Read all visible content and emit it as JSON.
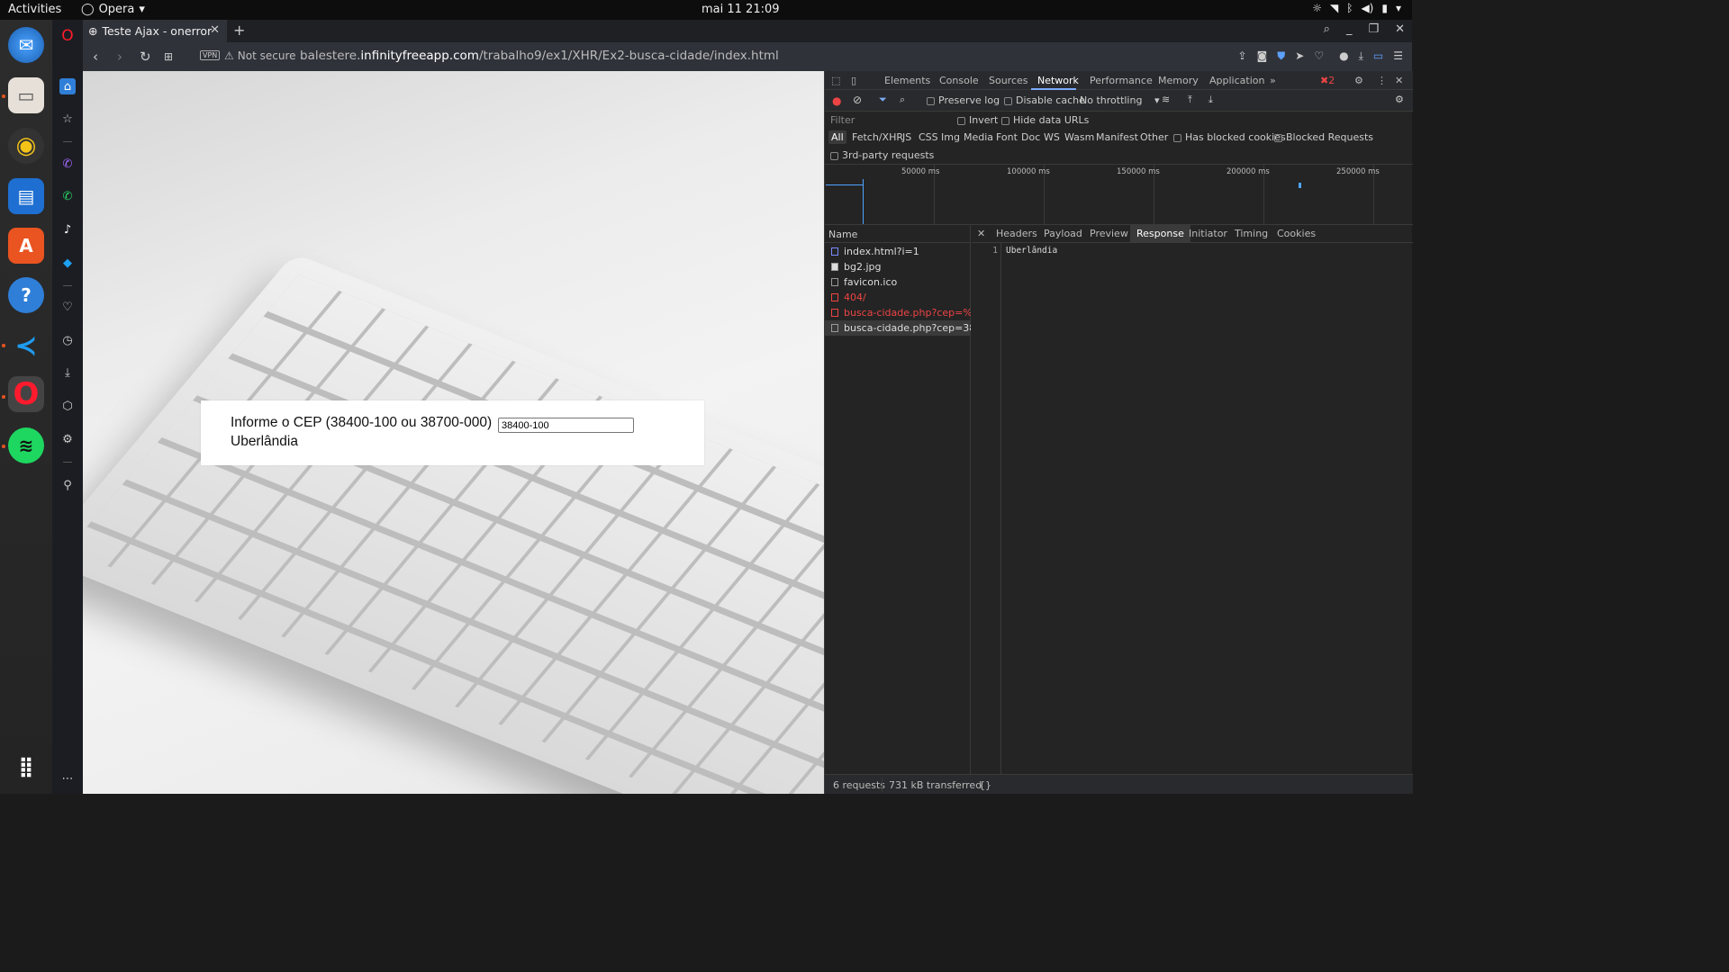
{
  "system": {
    "activities": "Activities",
    "app_name": "Opera",
    "clock": "mai 11  21:09"
  },
  "browser": {
    "tab_title": "Teste Ajax - onerror",
    "security_text": "Not secure",
    "vpn_badge": "VPN",
    "url_pre": "balestere.",
    "url_host": "infinityfreeapp.com",
    "url_path": "/trabalho9/ex1/XHR/Ex2-busca-cidade/index.html"
  },
  "page": {
    "label": "Informe o CEP (38400-100 ou 38700-000)",
    "cep_value": "38400-100",
    "result": "Uberlândia"
  },
  "devtools": {
    "tabs": [
      "Elements",
      "Console",
      "Sources",
      "Network",
      "Performance",
      "Memory",
      "Application"
    ],
    "active_tab": "Network",
    "error_count": "2",
    "preserve_log": "Preserve log",
    "disable_cache": "Disable cache",
    "throttling": "No throttling",
    "filter_placeholder": "Filter",
    "invert": "Invert",
    "hide_data_urls": "Hide data URLs",
    "type_filters": [
      "All",
      "Fetch/XHR",
      "JS",
      "CSS",
      "Img",
      "Media",
      "Font",
      "Doc",
      "WS",
      "Wasm",
      "Manifest",
      "Other"
    ],
    "has_blocked_cookies": "Has blocked cookies",
    "blocked_requests": "Blocked Requests",
    "third_party": "3rd-party requests",
    "timeline_labels": [
      "50000 ms",
      "100000 ms",
      "150000 ms",
      "200000 ms",
      "250000 ms"
    ],
    "name_header": "Name",
    "requests": [
      {
        "name": "index.html?i=1",
        "error": false
      },
      {
        "name": "bg2.jpg",
        "error": false
      },
      {
        "name": "favicon.ico",
        "error": false
      },
      {
        "name": "404/",
        "error": true
      },
      {
        "name": "busca-cidade.php?cep=%203...",
        "error": true
      },
      {
        "name": "busca-cidade.php?cep=3840...",
        "error": false
      }
    ],
    "detail_tabs": [
      "Headers",
      "Payload",
      "Preview",
      "Response",
      "Initiator",
      "Timing",
      "Cookies"
    ],
    "active_detail_tab": "Response",
    "response_line_no": "1",
    "response_text": "Uberlândia",
    "requests_count": "6 requests",
    "transferred": "731 kB transferred",
    "pretty_print": "{}"
  }
}
